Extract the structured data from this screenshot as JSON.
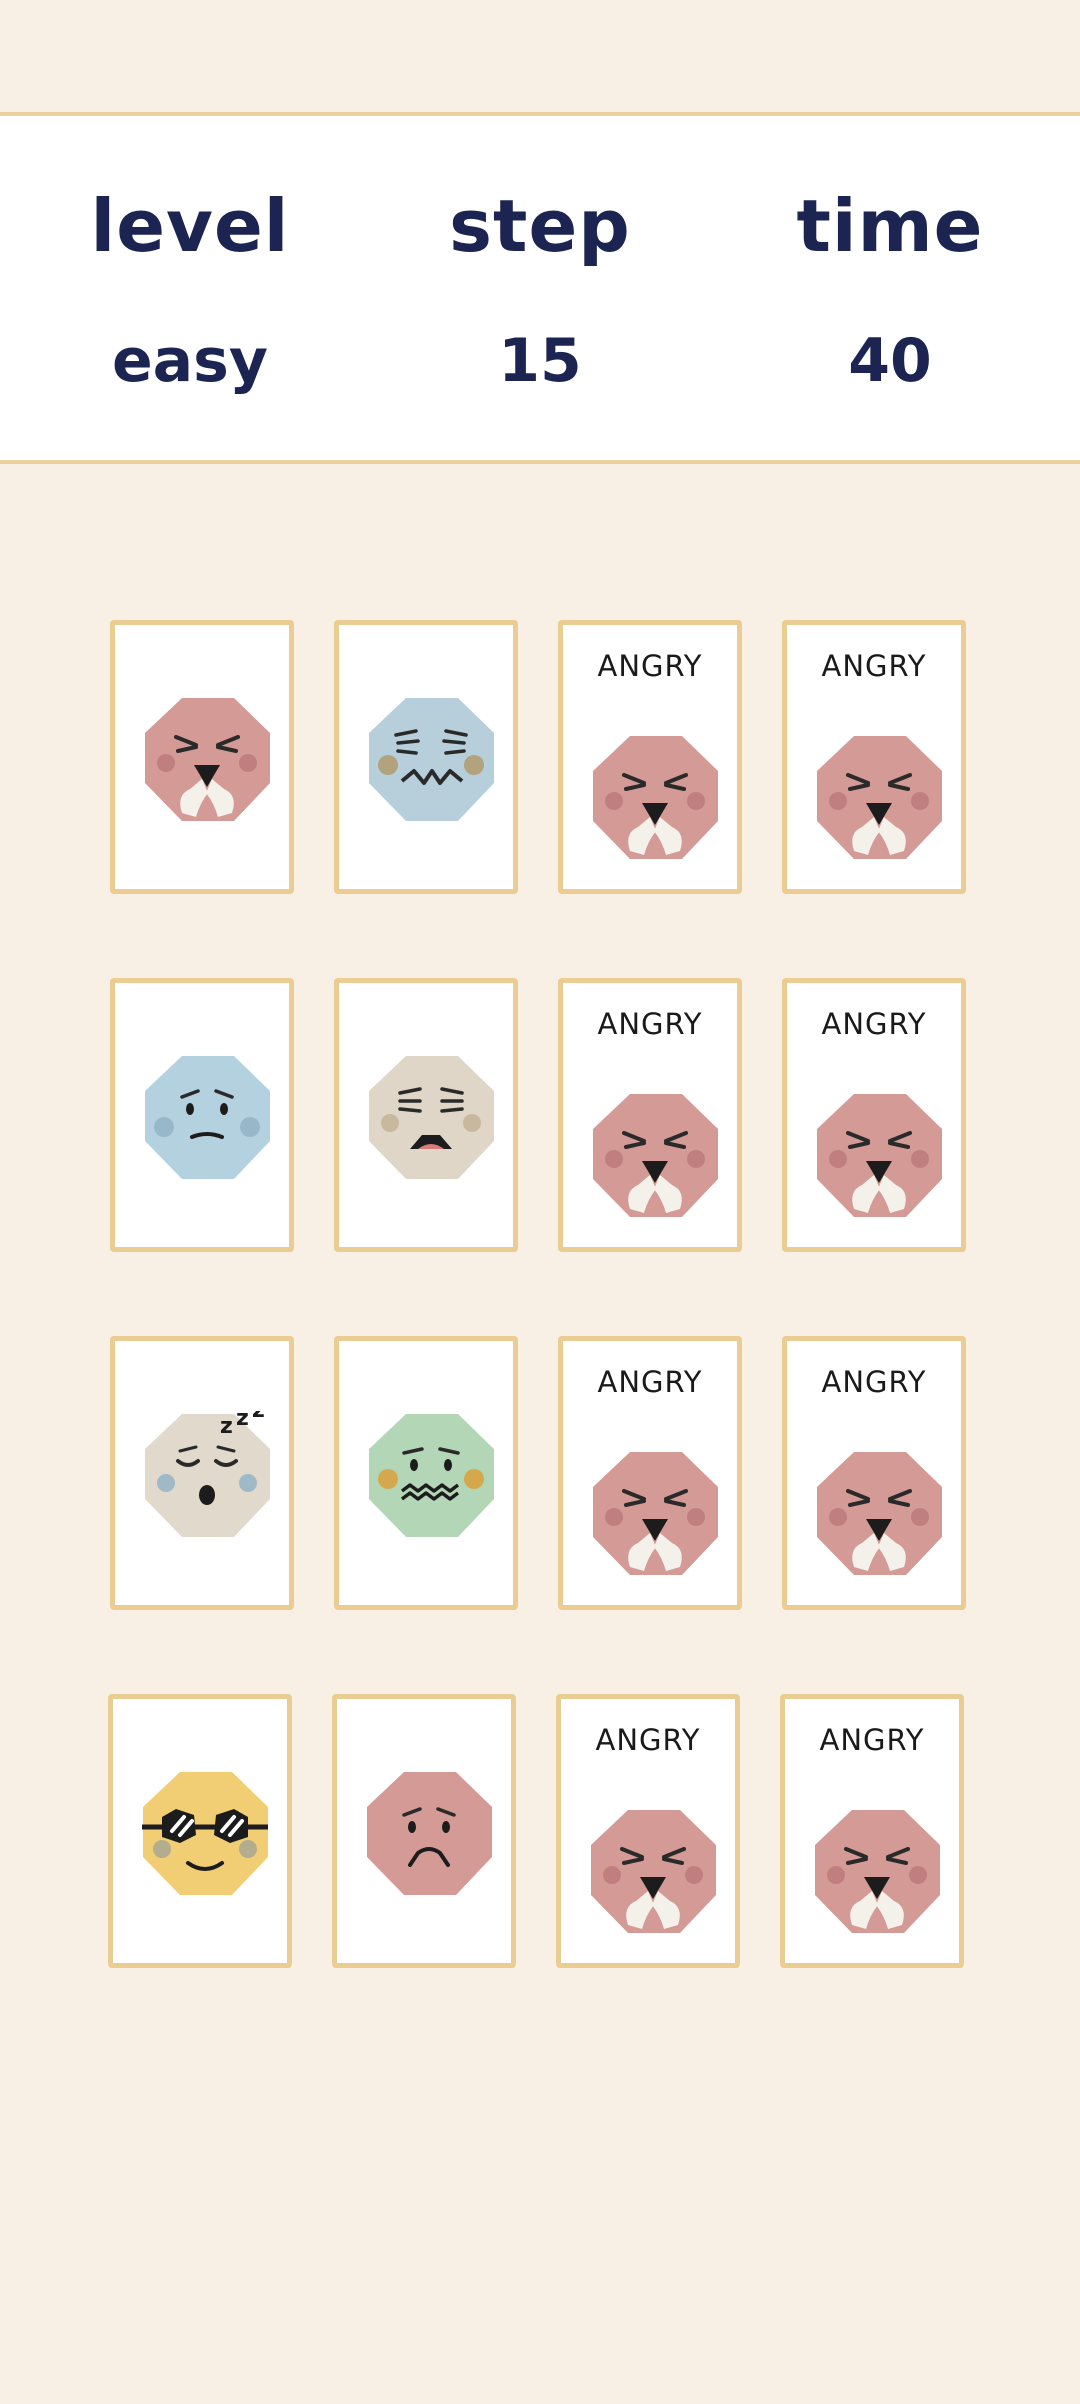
{
  "hud": {
    "level_label": "level",
    "step_label": "step",
    "time_label": "time",
    "level_value": "easy",
    "step_value": "15",
    "time_value": "40"
  },
  "colors": {
    "background": "#f8efe5",
    "card_border": "#ebcc92",
    "hud_text": "#1c2452",
    "angry": "#d49a96",
    "sad_blue": "#b6cfda",
    "worried_blue": "#b4d1df",
    "scared_beige": "#dfd6c8",
    "sleepy_beige": "#e1d9cb",
    "sick_green": "#b3d7b6",
    "cool_yellow": "#f1cd74",
    "frown_pink": "#d49a96"
  },
  "cards": [
    {
      "face": "angry-face-icon",
      "label": ""
    },
    {
      "face": "grimace-face-icon",
      "label": ""
    },
    {
      "face": "angry-face-icon",
      "label": "ANGRY"
    },
    {
      "face": "angry-face-icon",
      "label": "ANGRY"
    },
    {
      "face": "worried-face-icon",
      "label": ""
    },
    {
      "face": "scared-face-icon",
      "label": ""
    },
    {
      "face": "angry-face-icon",
      "label": "ANGRY"
    },
    {
      "face": "angry-face-icon",
      "label": "ANGRY"
    },
    {
      "face": "sleepy-face-icon",
      "label": ""
    },
    {
      "face": "nauseous-face-icon",
      "label": ""
    },
    {
      "face": "angry-face-icon",
      "label": "ANGRY"
    },
    {
      "face": "angry-face-icon",
      "label": "ANGRY"
    },
    {
      "face": "cool-sunglasses-face-icon",
      "label": ""
    },
    {
      "face": "frown-face-icon",
      "label": ""
    },
    {
      "face": "angry-face-icon",
      "label": "ANGRY"
    },
    {
      "face": "angry-face-icon",
      "label": "ANGRY"
    }
  ]
}
